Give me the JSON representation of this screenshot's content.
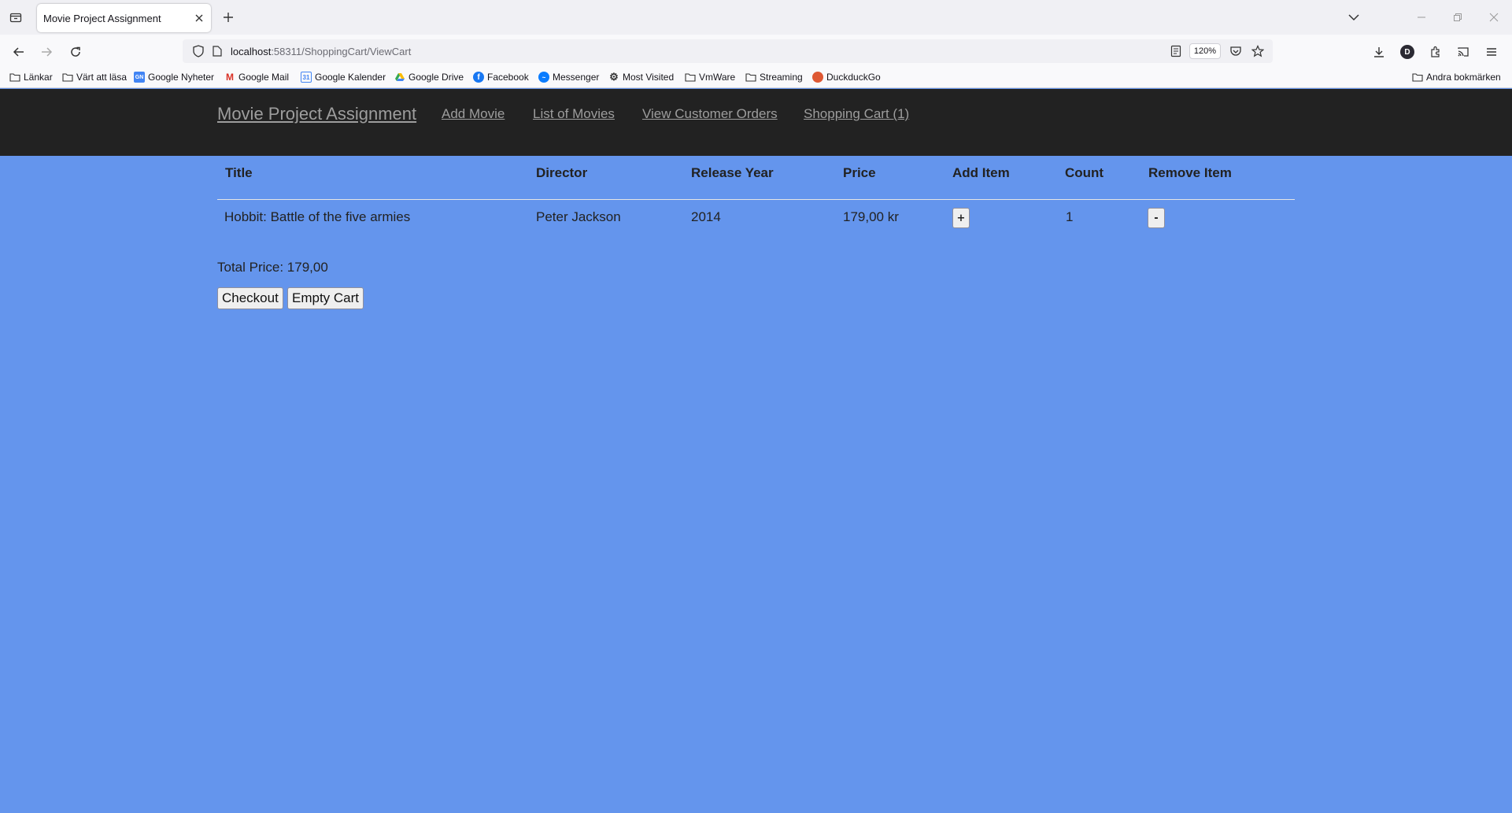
{
  "browser": {
    "tab_title": "Movie Project Assignment",
    "url_host": "localhost",
    "url_path": ":58311/ShoppingCart/ViewCart",
    "zoom": "120%",
    "profile_initial": "D",
    "bookmarks": [
      {
        "label": "Länkar",
        "icon": "folder-icon"
      },
      {
        "label": "Värt att läsa",
        "icon": "folder-icon"
      },
      {
        "label": "Google Nyheter",
        "icon": "google-news-icon"
      },
      {
        "label": "Google Mail",
        "icon": "gmail-icon"
      },
      {
        "label": "Google Kalender",
        "icon": "google-calendar-icon"
      },
      {
        "label": "Google Drive",
        "icon": "google-drive-icon"
      },
      {
        "label": "Facebook",
        "icon": "facebook-icon"
      },
      {
        "label": "Messenger",
        "icon": "messenger-icon"
      },
      {
        "label": "Most Visited",
        "icon": "gear-icon"
      },
      {
        "label": "VmWare",
        "icon": "folder-icon"
      },
      {
        "label": "Streaming",
        "icon": "folder-icon"
      },
      {
        "label": "DuckduckGo",
        "icon": "duckduckgo-icon"
      }
    ],
    "other_bookmarks": "Andra bokmärken"
  },
  "site": {
    "brand": "Movie Project Assignment",
    "nav": [
      "Add Movie",
      "List of Movies",
      "View Customer Orders",
      "Shopping Cart (1)"
    ]
  },
  "cart": {
    "headers": [
      "Title",
      "Director",
      "Release Year",
      "Price",
      "Add Item",
      "Count",
      "Remove Item"
    ],
    "rows": [
      {
        "title": "Hobbit: Battle of the five armies",
        "director": "Peter Jackson",
        "year": "2014",
        "price": "179,00 kr",
        "add_label": "+",
        "count": "1",
        "remove_label": "-"
      }
    ],
    "total_label": "Total Price: 179,00",
    "checkout_label": "Checkout",
    "empty_label": "Empty Cart"
  },
  "colors": {
    "page_background": "#6495ED",
    "header_background": "#222222",
    "nav_link": "#9d9d9d"
  }
}
